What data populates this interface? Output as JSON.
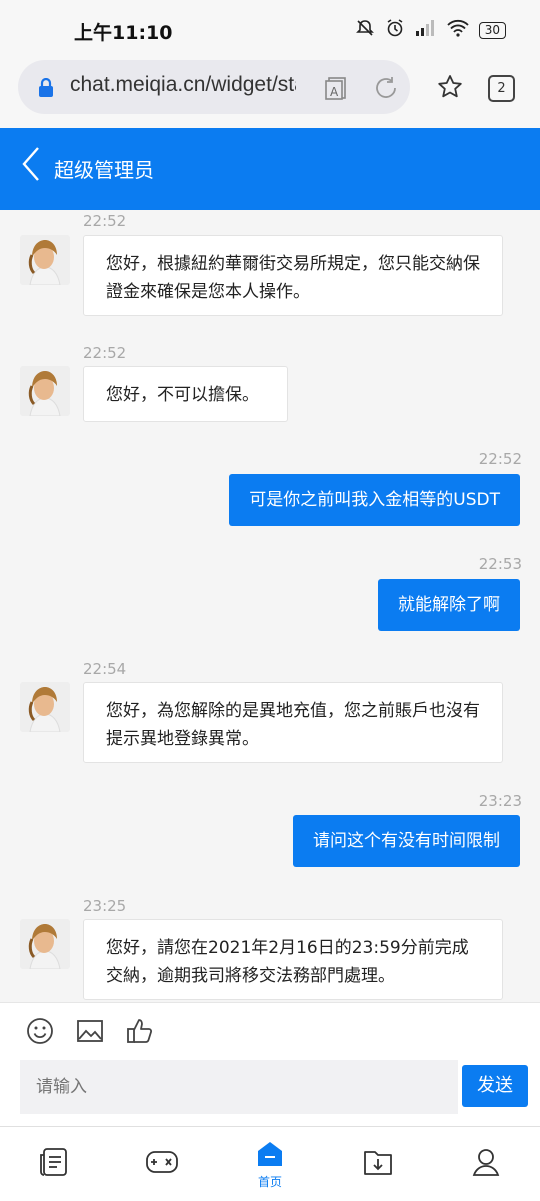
{
  "status": {
    "time": "上午11:10",
    "battery": "30"
  },
  "browser": {
    "url": "chat.meiqia.cn/widget/sta",
    "tab_count": "2"
  },
  "header": {
    "title": "超级管理员"
  },
  "messages": [
    {
      "time": "22:52",
      "text": "您好，根據紐約華爾街交易所規定，您只能交納保證金來確保是您本人操作。"
    },
    {
      "time": "22:52",
      "text": "您好，不可以擔保。"
    },
    {
      "time": "22:52",
      "text": "可是你之前叫我入金相等的USDT"
    },
    {
      "time": "22:53",
      "text": "就能解除了啊"
    },
    {
      "time": "22:54",
      "text": "您好，為您解除的是異地充值，您之前賬戶也沒有提示異地登錄異常。"
    },
    {
      "time": "23:23",
      "text": "请问这个有没有时间限制"
    },
    {
      "time": "23:25",
      "text": "您好，請您在2021年2月16日的23:59分前完成交納，逾期我司將移交法務部門處理。"
    }
  ],
  "composer": {
    "placeholder": "请输入",
    "send_label": "发送"
  },
  "nav": {
    "home_label": "首页"
  },
  "colors": {
    "accent": "#0b7cf1"
  }
}
